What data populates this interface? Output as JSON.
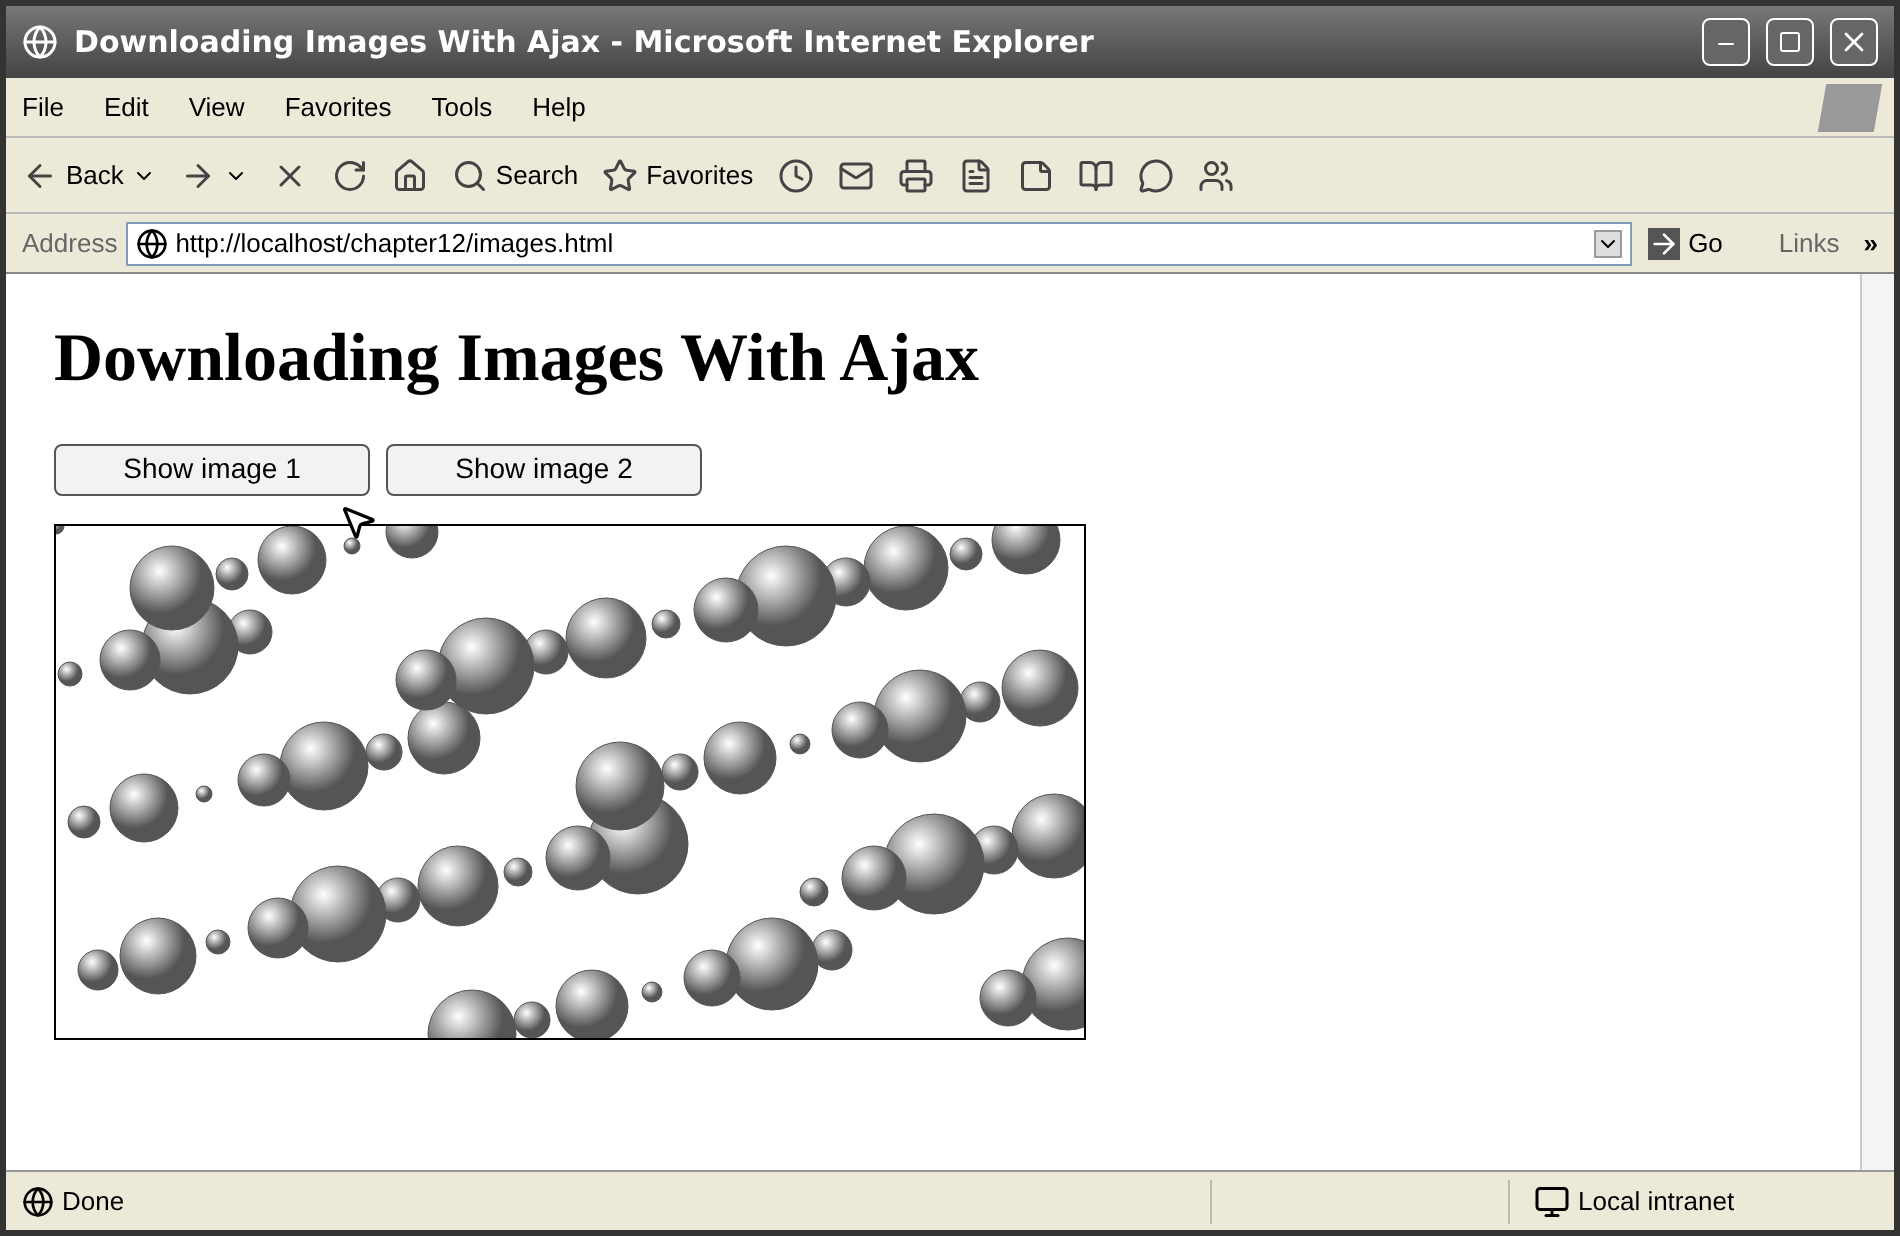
{
  "window": {
    "title": "Downloading Images With Ajax - Microsoft Internet Explorer"
  },
  "menu": [
    "File",
    "Edit",
    "View",
    "Favorites",
    "Tools",
    "Help"
  ],
  "toolbar": [
    {
      "kind": "back",
      "label": "Back"
    },
    {
      "kind": "forward"
    },
    {
      "kind": "stop"
    },
    {
      "kind": "refresh"
    },
    {
      "kind": "home"
    },
    {
      "kind": "search",
      "label": "Search"
    },
    {
      "kind": "favorites",
      "label": "Favorites"
    },
    {
      "kind": "history"
    },
    {
      "kind": "mail"
    },
    {
      "kind": "print"
    },
    {
      "kind": "edit"
    },
    {
      "kind": "note"
    },
    {
      "kind": "research"
    },
    {
      "kind": "messenger"
    },
    {
      "kind": "people"
    }
  ],
  "address": {
    "label": "Address",
    "value": "http://localhost/chapter12/images.html",
    "go": "Go",
    "links": "Links",
    "more": "»"
  },
  "page": {
    "heading": "Downloading Images With Ajax",
    "buttons": [
      {
        "label": "Show image 1"
      },
      {
        "label": "Show image 2"
      }
    ]
  },
  "status_bar": {
    "text": "Done",
    "zone": "Local intranet"
  }
}
